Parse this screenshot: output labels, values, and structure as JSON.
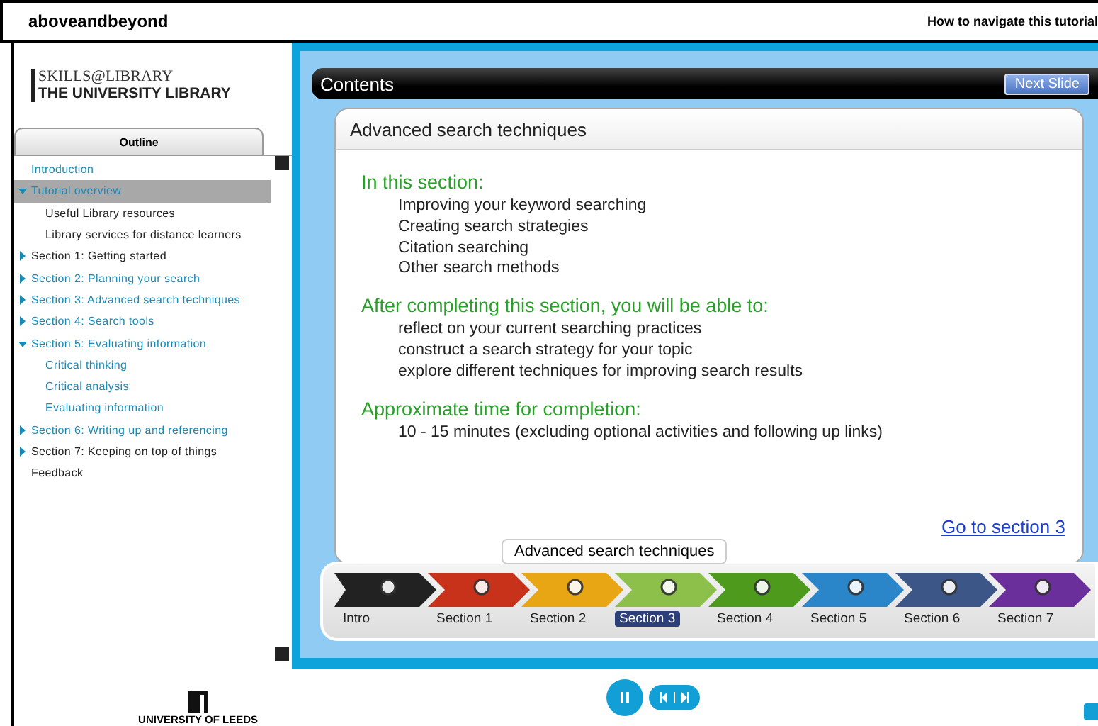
{
  "header": {
    "site": "aboveandbeyond",
    "help_link": "How to navigate this tutorial"
  },
  "brand": {
    "line1": "SKILLS@LIBRARY",
    "line2": "THE UNIVERSITY LIBRARY"
  },
  "outline": {
    "title": "Outline",
    "items": [
      {
        "label": "Introduction",
        "visited": false,
        "selected": false
      },
      {
        "label": "Tutorial overview",
        "visited": false,
        "selected": true,
        "expanded": true,
        "children": [
          {
            "label": "Useful Library resources",
            "visited": true,
            "selected": false
          },
          {
            "label": "Library services for distance learners",
            "visited": true,
            "selected": false
          }
        ]
      },
      {
        "label": "Section 1: Getting started",
        "visited": true,
        "selected": false,
        "expanded": false
      },
      {
        "label": "Section 2: Planning your search",
        "visited": false,
        "selected": false,
        "expanded": false
      },
      {
        "label": "Section 3: Advanced search techniques",
        "visited": false,
        "selected": false,
        "expanded": false
      },
      {
        "label": "Section 4: Search tools",
        "visited": false,
        "selected": false,
        "expanded": false
      },
      {
        "label": "Section 5: Evaluating information",
        "visited": false,
        "selected": false,
        "expanded": true,
        "children": [
          {
            "label": "Critical thinking",
            "visited": false,
            "selected": false
          },
          {
            "label": "Critical analysis",
            "visited": false,
            "selected": false
          },
          {
            "label": "Evaluating information",
            "visited": false,
            "selected": false
          }
        ]
      },
      {
        "label": "Section 6: Writing up and referencing",
        "visited": false,
        "selected": false,
        "expanded": false
      },
      {
        "label": "Section 7: Keeping on top of things",
        "visited": true,
        "selected": false,
        "expanded": false
      },
      {
        "label": "Feedback",
        "visited": true,
        "selected": false
      }
    ]
  },
  "footer_logo": "UNIVERSITY OF LEEDS",
  "slide": {
    "bar_title": "Contents",
    "next_button": "Next Slide",
    "card_title": "Advanced search techniques",
    "blocks": [
      {
        "heading": "In this section:",
        "lines": [
          "Improving your keyword searching",
          "Creating search strategies",
          "Citation searching",
          "Other search methods"
        ]
      },
      {
        "heading": "After completing this section, you will be able to:",
        "lines": [
          "reflect on your current searching practices",
          "construct a search strategy for your topic",
          "explore different techniques for improving search results"
        ]
      },
      {
        "heading": "Approximate time for completion:",
        "lines": [
          "10 - 15 minutes (excluding optional activities and following up links)"
        ]
      }
    ],
    "link": "Go to section 3"
  },
  "timeline": {
    "tooltip": "Advanced search techniques",
    "steps": [
      {
        "label": "Intro",
        "color": "#222222",
        "selected": false
      },
      {
        "label": "Section 1",
        "color": "#c8321a",
        "selected": false
      },
      {
        "label": "Section 2",
        "color": "#e8a514",
        "selected": false
      },
      {
        "label": "Section 3",
        "color": "#8cc04a",
        "selected": true
      },
      {
        "label": "Section 4",
        "color": "#4e9a1c",
        "selected": false
      },
      {
        "label": "Section 5",
        "color": "#2a86c8",
        "selected": false
      },
      {
        "label": "Section 6",
        "color": "#3c5688",
        "selected": false
      },
      {
        "label": "Section 7",
        "color": "#6a2f9a",
        "selected": false
      }
    ]
  }
}
